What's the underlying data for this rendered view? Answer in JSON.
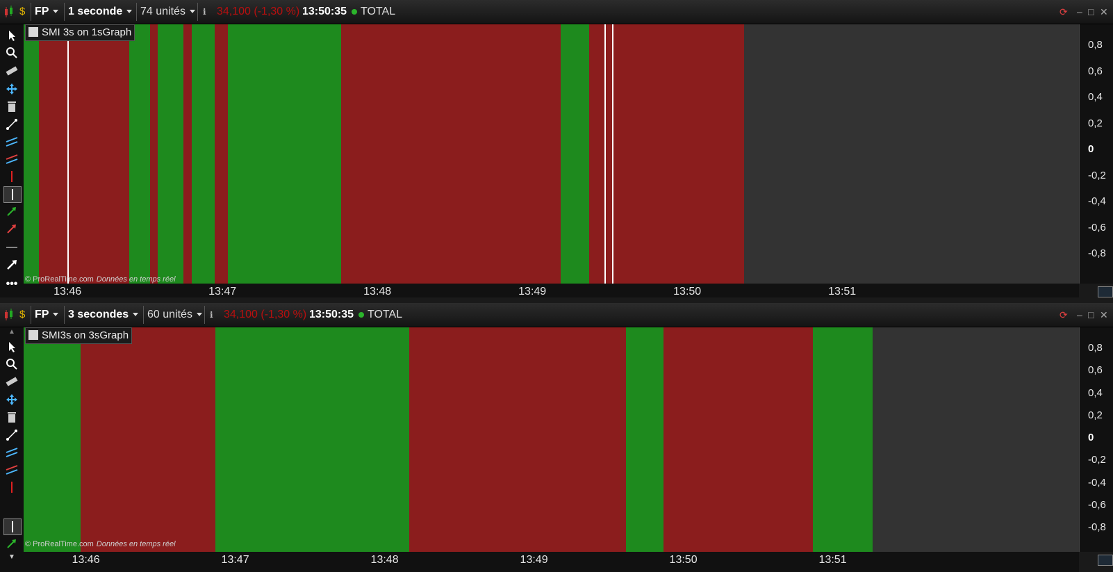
{
  "colors": {
    "green": "#1e8a1e",
    "red": "#8b1d1d",
    "bg": "#333333",
    "line": "#ffffff"
  },
  "top": {
    "symbol": "FP",
    "timeframe": "1 seconde",
    "units": "74 unités",
    "price_change": "34,100 (-1,30 %)",
    "time": "13:50:35",
    "market": "TOTAL",
    "indicator": "SMI 3s on 1sGraph",
    "copyright": "© ProRealTime.com",
    "realtime": "Données en temps réel",
    "y_ticks": [
      "0,8",
      "0,6",
      "0,4",
      "0,2",
      "0",
      "-0,2",
      "-0,4",
      "-0,6",
      "-0,8"
    ],
    "x_ticks": [
      "13:46",
      "13:47",
      "13:48",
      "13:49",
      "13:50",
      "13:51"
    ]
  },
  "bottom": {
    "symbol": "FP",
    "timeframe": "3 secondes",
    "units": "60 unités",
    "price_change": "34,100 (-1,30 %)",
    "time": "13:50:35",
    "market": "TOTAL",
    "indicator": "SMI3s on 3sGraph",
    "copyright": "© ProRealTime.com",
    "realtime": "Données en temps réel",
    "y_ticks": [
      "0,8",
      "0,6",
      "0,4",
      "0,2",
      "0",
      "-0,2",
      "-0,4",
      "-0,6",
      "-0,8"
    ],
    "x_ticks": [
      "13:46",
      "13:47",
      "13:48",
      "13:49",
      "13:50",
      "13:51"
    ]
  },
  "chart_data": [
    {
      "type": "color-bands",
      "title": "SMI 3s on 1sGraph",
      "ylim": [
        -1,
        1
      ],
      "x_axis": "time",
      "segments": [
        {
          "start": "13:45:43",
          "end": "13:45:49",
          "state": "green"
        },
        {
          "start": "13:45:49",
          "end": "13:46:24",
          "state": "red"
        },
        {
          "start": "13:46:24",
          "end": "13:46:32",
          "state": "green"
        },
        {
          "start": "13:46:32",
          "end": "13:46:35",
          "state": "red"
        },
        {
          "start": "13:46:35",
          "end": "13:46:45",
          "state": "green"
        },
        {
          "start": "13:46:45",
          "end": "13:46:48",
          "state": "red"
        },
        {
          "start": "13:46:48",
          "end": "13:46:57",
          "state": "green"
        },
        {
          "start": "13:46:57",
          "end": "13:47:02",
          "state": "red"
        },
        {
          "start": "13:47:02",
          "end": "13:47:46",
          "state": "green"
        },
        {
          "start": "13:47:46",
          "end": "13:49:11",
          "state": "red"
        },
        {
          "start": "13:49:11",
          "end": "13:49:22",
          "state": "green"
        },
        {
          "start": "13:49:22",
          "end": "13:50:22",
          "state": "red"
        }
      ],
      "vertical_lines": [
        "13:46:00",
        "13:49:28",
        "13:49:31"
      ]
    },
    {
      "type": "color-bands",
      "title": "SMI3s on 3sGraph",
      "ylim": [
        -1,
        1
      ],
      "x_axis": "time",
      "segments": [
        {
          "start": "13:45:35",
          "end": "13:45:58",
          "state": "green"
        },
        {
          "start": "13:45:58",
          "end": "13:46:52",
          "state": "red"
        },
        {
          "start": "13:46:52",
          "end": "13:48:10",
          "state": "green"
        },
        {
          "start": "13:48:10",
          "end": "13:49:37",
          "state": "red"
        },
        {
          "start": "13:49:37",
          "end": "13:49:52",
          "state": "green"
        },
        {
          "start": "13:49:52",
          "end": "13:50:52",
          "state": "red"
        },
        {
          "start": "13:50:52",
          "end": "13:51:16",
          "state": "green"
        }
      ],
      "vertical_lines": []
    }
  ],
  "tools": [
    "pointer-icon",
    "zoom-icon",
    "ruler-icon",
    "move-icon",
    "trash-icon",
    "node-line-icon",
    "channel-blue-icon",
    "channel-red-icon",
    "red-line-icon",
    "vertical-line-icon",
    "green-arrow-icon",
    "red-arrow-icon",
    "horizontal-line-icon",
    "white-arrow-icon",
    "more-icon"
  ]
}
